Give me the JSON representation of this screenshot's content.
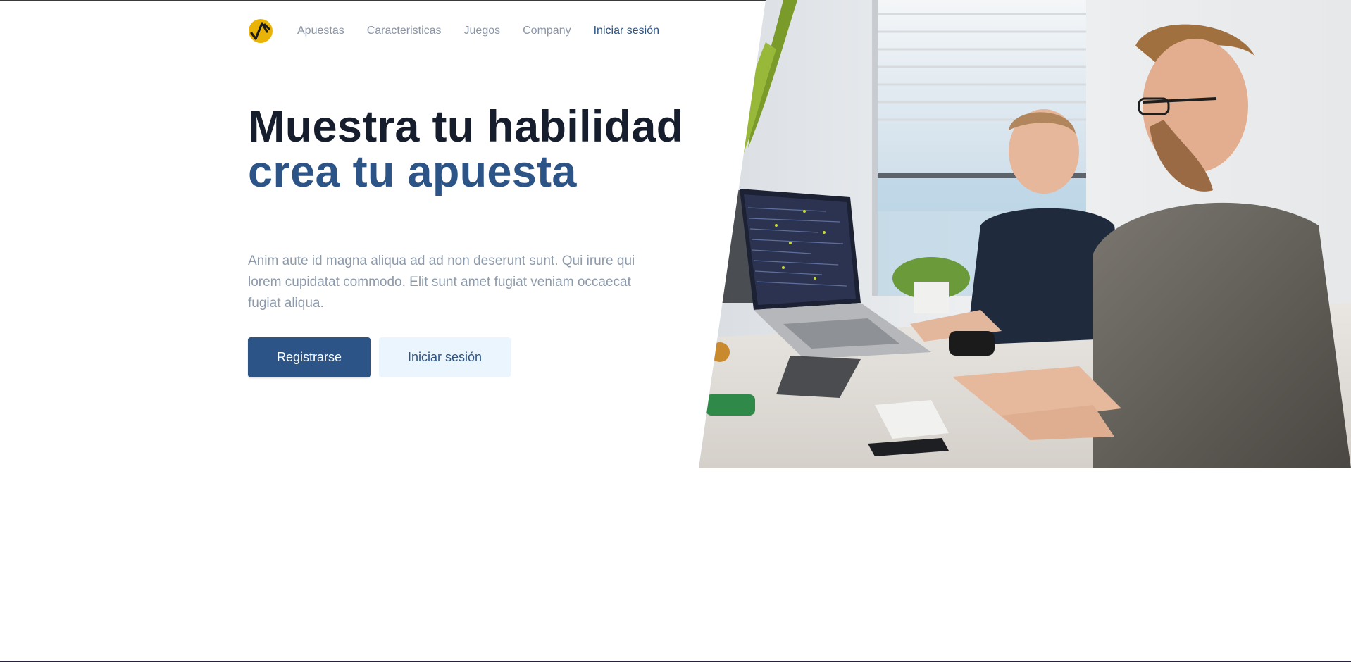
{
  "brand": {
    "logo_icon": "wave-check-logo",
    "accent_color": "#eab308"
  },
  "nav": {
    "links": [
      "Apuestas",
      "Caracteristicas",
      "Juegos",
      "Company"
    ],
    "login": "Iniciar sesión"
  },
  "hero": {
    "title_part1": "Muestra tu habilidad ",
    "title_accent": "crea tu apuesta",
    "description": "Anim aute id magna aliqua ad ad non deserunt sunt. Qui irure qui lorem cupidatat commodo. Elit sunt amet fugiat veniam occaecat fugiat aliqua.",
    "primary_button": "Registrarse",
    "secondary_button": "Iniciar sesión"
  },
  "colors": {
    "primary": "#2c5486",
    "dark_text": "#161e2d",
    "muted_text": "#8d9aaa",
    "secondary_bg": "#eaf5fd"
  }
}
